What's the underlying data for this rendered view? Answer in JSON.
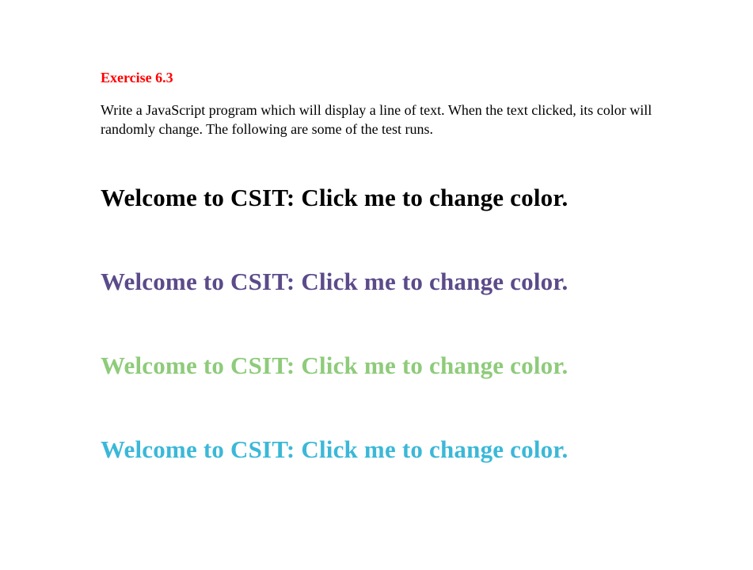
{
  "exercise": {
    "title": "Exercise 6.3",
    "description": "Write a JavaScript program which will display a line of text. When the text clicked, its color will randomly change. The following are some of the test runs."
  },
  "samples": [
    {
      "text": "Welcome to CSIT: Click me to change color.",
      "color": "#000000"
    },
    {
      "text": "Welcome to CSIT: Click me to change color.",
      "color": "#5b4b8a"
    },
    {
      "text": "Welcome to CSIT: Click me to change color.",
      "color": "#8ecb7a"
    },
    {
      "text": "Welcome to CSIT: Click me to change color.",
      "color": "#3bb8d8"
    }
  ]
}
